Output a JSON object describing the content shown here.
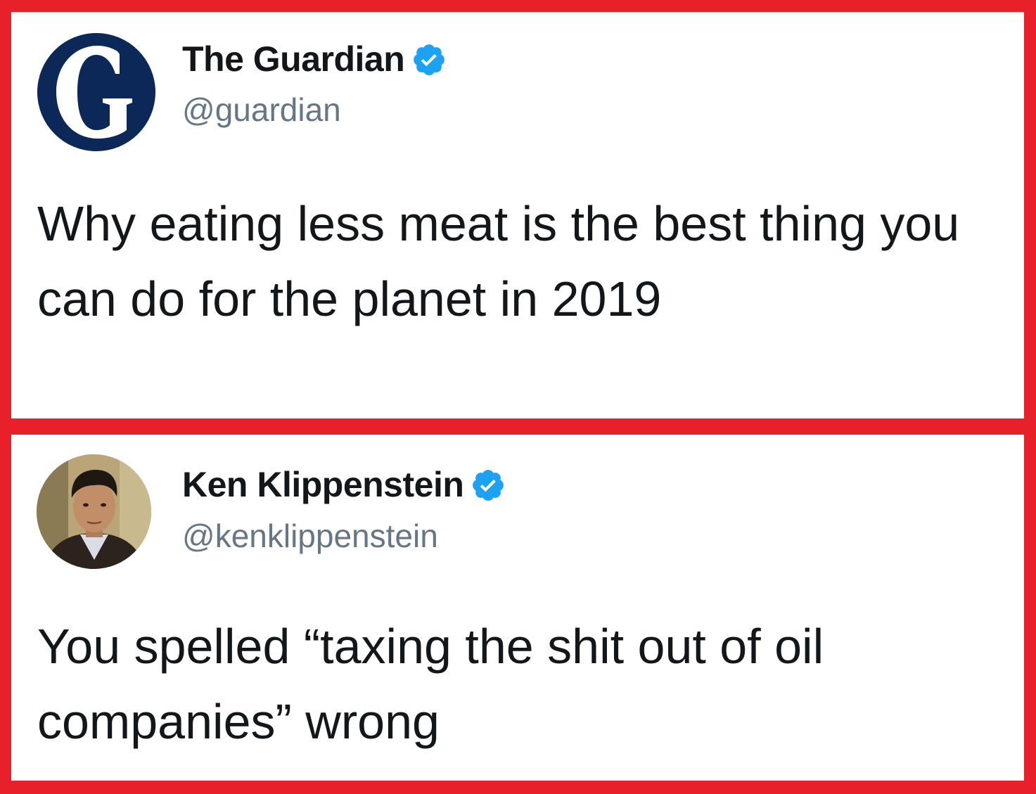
{
  "tweets": [
    {
      "author": {
        "name": "The Guardian",
        "handle": "@guardian",
        "verified": true,
        "avatar_icon": "guardian-g-logo"
      },
      "text": "Why eating less meat is the best thing you can do for the planet in 2019"
    },
    {
      "author": {
        "name": "Ken Klippenstein",
        "handle": "@kenklippenstein",
        "verified": true,
        "avatar_icon": "profile-photo"
      },
      "text": "You spelled “taxing the shit out of oil companies” wrong"
    }
  ],
  "colors": {
    "frame": "#e8202a",
    "card": "#ffffff",
    "guardian_navy": "#0b2858",
    "verified_blue": "#1da1f2",
    "name_text": "#14171a",
    "handle_text": "#657786"
  }
}
